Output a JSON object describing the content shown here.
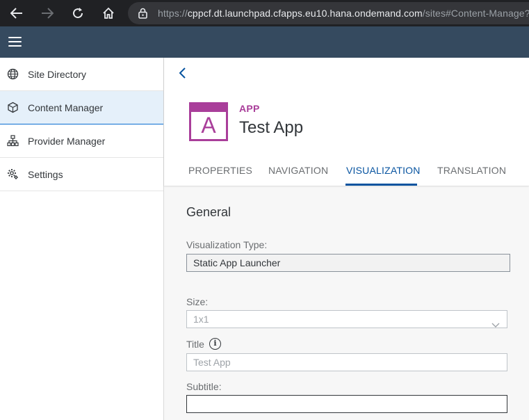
{
  "browser": {
    "url_host": "cppcf.dt.launchpad.cfapps.eu10.hana.ondemand.com",
    "url_path": "/sites#Content-Manage?s"
  },
  "sidebar": {
    "items": [
      {
        "label": "Site Directory",
        "icon": "globe-icon"
      },
      {
        "label": "Content Manager",
        "icon": "cube-icon",
        "selected": true
      },
      {
        "label": "Provider Manager",
        "icon": "hierarchy-icon"
      },
      {
        "label": "Settings",
        "icon": "gear-icon"
      }
    ]
  },
  "app": {
    "tile_letter": "A",
    "type_label": "APP",
    "title": "Test App",
    "accent_color": "#a93e9a"
  },
  "tabs": [
    {
      "label": "PROPERTIES"
    },
    {
      "label": "NAVIGATION"
    },
    {
      "label": "VISUALIZATION",
      "active": true
    },
    {
      "label": "TRANSLATION"
    }
  ],
  "form": {
    "section_title": "General",
    "visualization_type_label": "Visualization Type:",
    "visualization_type_value": "Static App Launcher",
    "size_label": "Size:",
    "size_value": "1x1",
    "title_label": "Title",
    "title_placeholder": "Test App",
    "subtitle_label": "Subtitle:",
    "subtitle_value": ""
  }
}
